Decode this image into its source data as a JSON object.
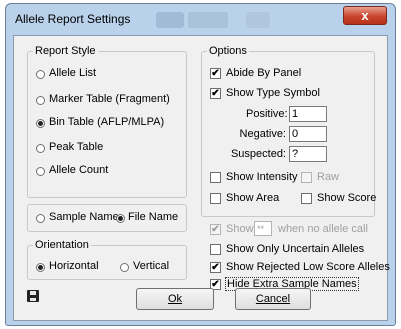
{
  "window": {
    "title": "Allele Report Settings",
    "close_glyph": "x"
  },
  "report_style": {
    "legend": "Report Style",
    "options": [
      "Allele List",
      "Marker Table (Fragment)",
      "Bin Table (AFLP/MLPA)",
      "Peak Table",
      "Allele Count"
    ],
    "selected": "Bin Table (AFLP/MLPA)"
  },
  "name_choice": {
    "options": [
      "Sample Name",
      "File Name"
    ],
    "selected": "File Name"
  },
  "orientation": {
    "legend": "Orientation",
    "options": [
      "Horizontal",
      "Vertical"
    ],
    "selected": "Horizontal"
  },
  "options_group": {
    "legend": "Options",
    "abide_by_panel": {
      "label": "Abide By Panel",
      "checked": true
    },
    "show_type_symbol": {
      "label": "Show Type Symbol",
      "checked": true
    },
    "positive": {
      "label": "Positive:",
      "value": "1"
    },
    "negative": {
      "label": "Negative:",
      "value": "0"
    },
    "suspected": {
      "label": "Suspected:",
      "value": "?"
    },
    "show_intensity": {
      "label": "Show Intensity",
      "checked": false
    },
    "raw": {
      "label": "Raw",
      "checked": false
    },
    "show_area": {
      "label": "Show Area",
      "checked": false
    },
    "show_score": {
      "label": "Show Score",
      "checked": false
    }
  },
  "no_allele": {
    "label_show": "Show",
    "value": "**",
    "label_after": "when no allele call",
    "checked": true
  },
  "show_only_uncertain": {
    "label": "Show Only Uncertain Alleles",
    "checked": false
  },
  "show_rejected": {
    "label": "Show Rejected Low Score Alleles",
    "checked": true
  },
  "hide_extra": {
    "label": "Hide Extra Sample Names",
    "checked": true
  },
  "buttons": {
    "ok": "Ok",
    "cancel": "Cancel"
  },
  "check_glyph": "✔"
}
